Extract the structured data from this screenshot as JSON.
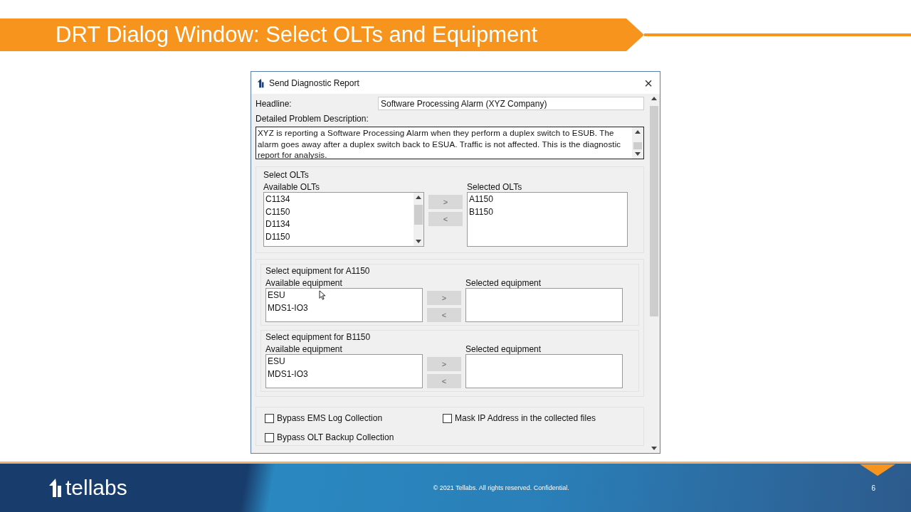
{
  "slide": {
    "title": "DRT Dialog Window: Select OLTs and Equipment"
  },
  "dialog": {
    "title": "Send Diagnostic Report",
    "close": "×",
    "headline": {
      "label": "Headline:",
      "value": "Software Processing Alarm (XYZ Company)"
    },
    "description": {
      "label": "Detailed Problem Description:",
      "value": "XYZ is reporting a Software Processing Alarm when they perform a duplex switch to ESUB. The alarm goes away after a duplex switch back to ESUA. Traffic is not affected.  This is the diagnostic report for analysis."
    },
    "olt_section": {
      "title": "Select OLTs",
      "available_label": "Available OLTs",
      "available": [
        "C1134",
        "C1150",
        "D1134",
        "D1150"
      ],
      "selected_label": "Selected OLTs",
      "selected": [
        "A1150",
        "B1150"
      ],
      "buttons": [
        {
          "label": ">",
          "disabled": true
        },
        {
          "label": "<",
          "disabled": true
        }
      ]
    },
    "equipment_sections": [
      {
        "title": "Select equipment for A1150",
        "available_label": "Available equipment",
        "available": [
          "ESU",
          "MDS1-IO3"
        ],
        "selected_label": "Selected equipment",
        "buttons": [
          {
            "label": ">",
            "disabled": true
          },
          {
            "label": "<",
            "disabled": true
          }
        ]
      },
      {
        "title": "Select equipment for B1150",
        "available_label": "Available equipment",
        "available": [
          "ESU",
          "MDS1-IO3"
        ],
        "selected_label": "Selected equipment",
        "buttons": [
          {
            "label": ">",
            "disabled": true
          },
          {
            "label": "<",
            "disabled": true
          }
        ]
      }
    ],
    "options": [
      {
        "label": "Bypass EMS Log Collection",
        "checked": false
      },
      {
        "label": "Mask IP Address in the collected files",
        "checked": false
      },
      {
        "label": "Bypass OLT Backup Collection",
        "checked": false
      }
    ]
  },
  "footer": {
    "logo_text": "tellabs",
    "copyright": "© 2021 Tellabs.  All rights reserved. Confidential.",
    "page": "6"
  }
}
